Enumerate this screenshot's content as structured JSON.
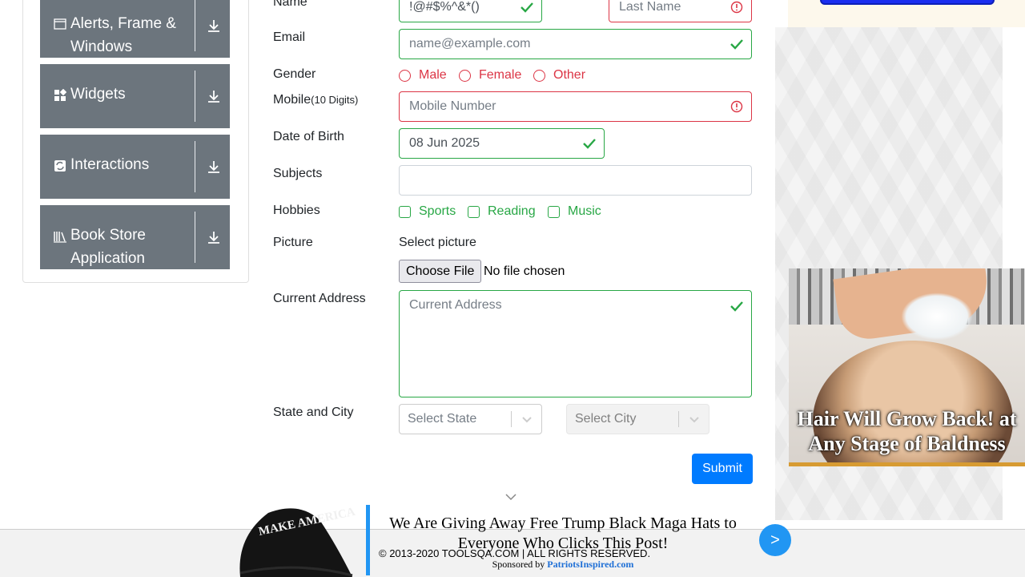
{
  "sidebar": {
    "groups": [
      {
        "label_line1": "Alerts, Frame &",
        "label_line2": "Windows",
        "icon": "window-icon"
      },
      {
        "label": "Widgets",
        "icon": "widgets-icon"
      },
      {
        "label": "Interactions",
        "icon": "interactions-icon"
      },
      {
        "label_line1": "Book Store",
        "label_line2": "Application",
        "icon": "books-icon"
      }
    ]
  },
  "form": {
    "name_label": "Name",
    "first_name_value": "!@#$%^&*()",
    "last_name_placeholder": "Last Name",
    "email_label": "Email",
    "email_placeholder": "name@example.com",
    "gender_label": "Gender",
    "gender_options": [
      "Male",
      "Female",
      "Other"
    ],
    "mobile_label": "Mobile",
    "mobile_hint": "(10 Digits)",
    "mobile_placeholder": "Mobile Number",
    "dob_label": "Date of Birth",
    "dob_value": "08 Jun 2025",
    "subjects_label": "Subjects",
    "hobbies_label": "Hobbies",
    "hobbies_options": [
      "Sports",
      "Reading",
      "Music"
    ],
    "picture_label": "Picture",
    "select_picture": "Select picture",
    "choose_file": "Choose File",
    "file_status": "No file chosen",
    "address_label": "Current Address",
    "address_placeholder": "Current Address",
    "state_city_label": "State and City",
    "state_placeholder": "Select State",
    "city_placeholder": "Select City",
    "submit": "Submit"
  },
  "ads": {
    "side_caption": "Hair Will Grow Back! at Any Stage of Baldness",
    "bottom_text": "We Are Giving Away Free Trump Black Maga Hats to Everyone Who Clicks This Post!",
    "sponsored_prefix": "Sponsored by ",
    "sponsor": "PatriotsInspired.com",
    "next": ">",
    "hat_text": "MAKE AMERICA GREAT AGAIN"
  },
  "footer": {
    "copyright": "© 2013-2020 TOOLSQA.COM | ALL RIGHTS RESERVED."
  },
  "colors": {
    "valid": "#28a745",
    "invalid": "#dc3545",
    "primary": "#007bff",
    "group_bg": "#6c757d"
  }
}
